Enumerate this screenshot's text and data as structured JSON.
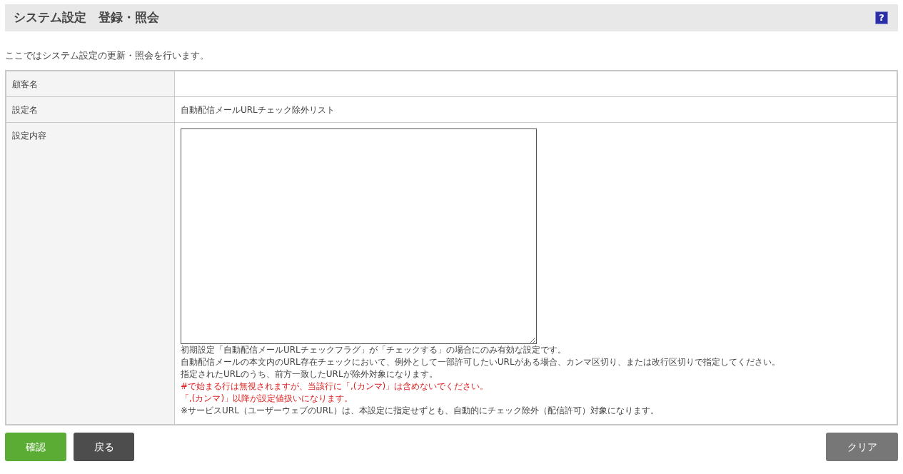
{
  "header": {
    "title": "システム設定　登録・照会",
    "help_icon": "?"
  },
  "description": "ここではシステム設定の更新・照会を行います。",
  "form": {
    "rows": [
      {
        "label": "顧客名",
        "kind": "text"
      },
      {
        "label": "設定名",
        "kind": "text",
        "value": "自動配信メールURLチェック除外リスト"
      },
      {
        "label": "設定内容",
        "kind": "textarea",
        "notes": [
          {
            "text": "初期設定「自動配信メールURLチェックフラグ」が「チェックする」の場合にのみ有効な設定です。",
            "kind": "normal"
          },
          {
            "text": "自動配信メールの本文内のURL存在チェックにおいて、例外として一部許可したいURLがある場合、カンマ区切り、または改行区切りで指定してください。",
            "kind": "normal"
          },
          {
            "text": "指定されたURLのうち、前方一致したURLが除外対象になります。",
            "kind": "normal"
          },
          {
            "text": "#で始まる行は無視されますが、当該行に「,(カンマ)」は含めないでください。",
            "kind": "warning"
          },
          {
            "text": "「,(カンマ)」以降が設定値扱いになります。",
            "kind": "warning"
          },
          {
            "text": "※サービスURL（ユーザーウェブのURL）は、本設定に指定せずとも、自動的にチェック除外（配信許可）対象になります。",
            "kind": "normal"
          }
        ]
      }
    ]
  },
  "buttons": [
    {
      "label": "確認",
      "kind": "primary"
    },
    {
      "label": "戻る",
      "kind": "back"
    },
    {
      "label": "クリア",
      "kind": "clear"
    }
  ]
}
